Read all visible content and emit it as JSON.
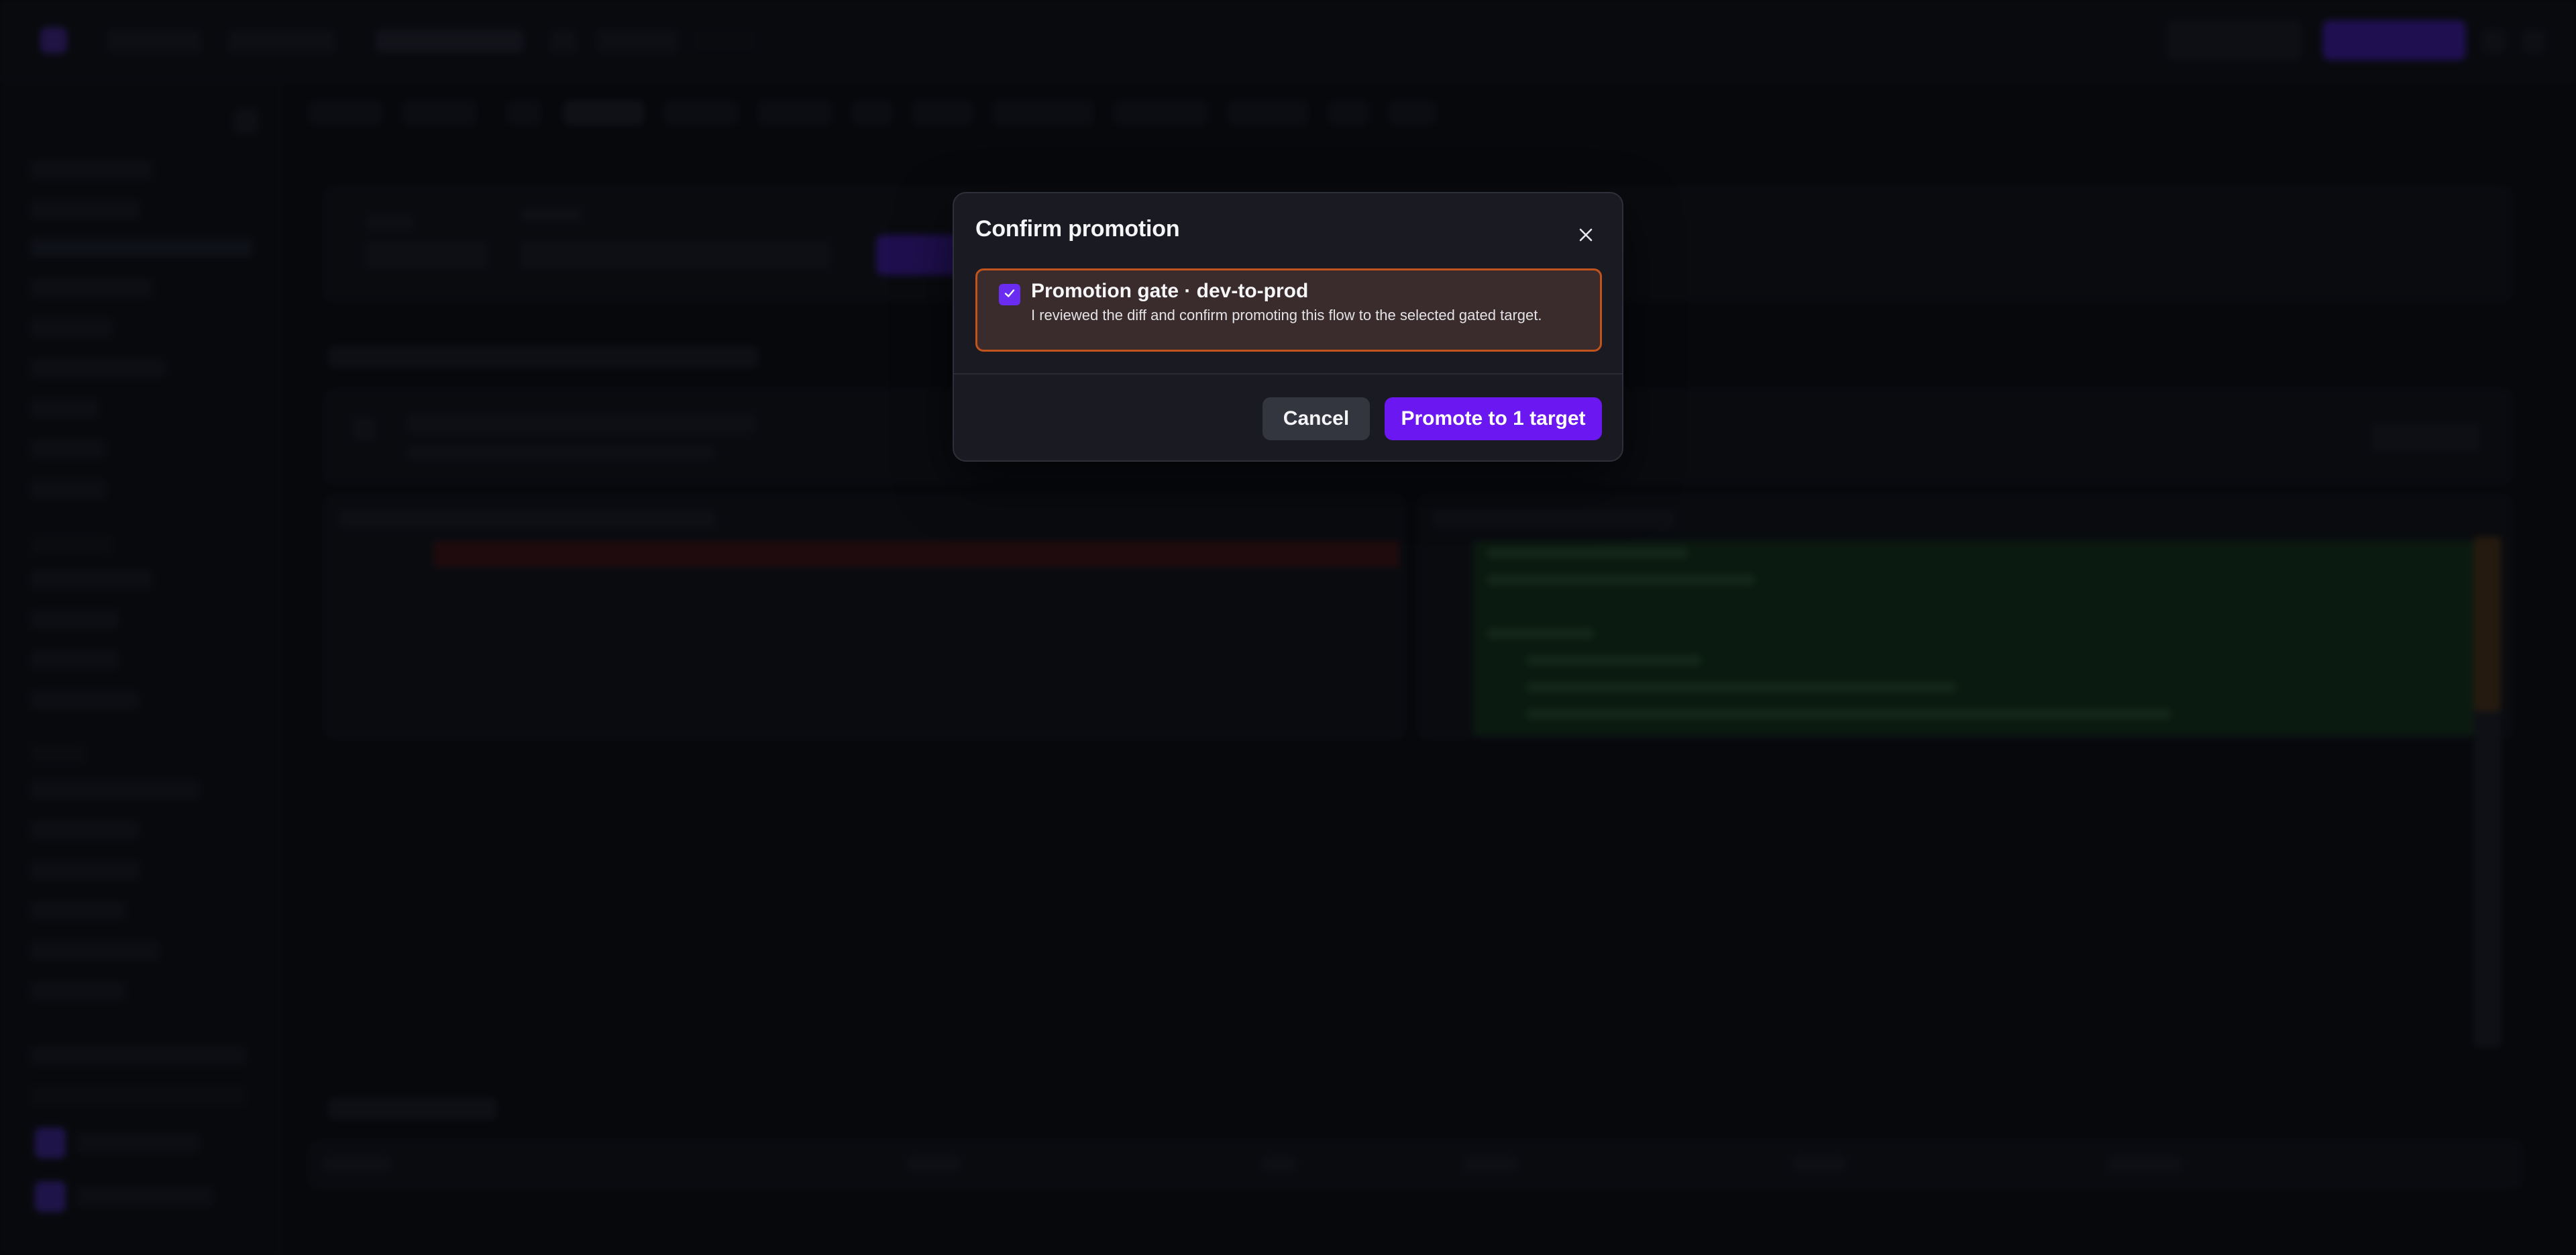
{
  "modal": {
    "title": "Confirm promotion",
    "close_icon": "close-icon",
    "gate": {
      "checked": true,
      "title": "Promotion gate · dev-to-prod",
      "description": "I reviewed the diff and confirm promoting this flow to the selected gated target."
    },
    "cancel_label": "Cancel",
    "promote_label": "Promote to 1 target"
  },
  "colors": {
    "accent": "#6a17f2",
    "gate_border": "#c2531d",
    "gate_background": "#3a2c2c",
    "modal_background": "#1a1b22",
    "page_background": "#0b0c10"
  }
}
